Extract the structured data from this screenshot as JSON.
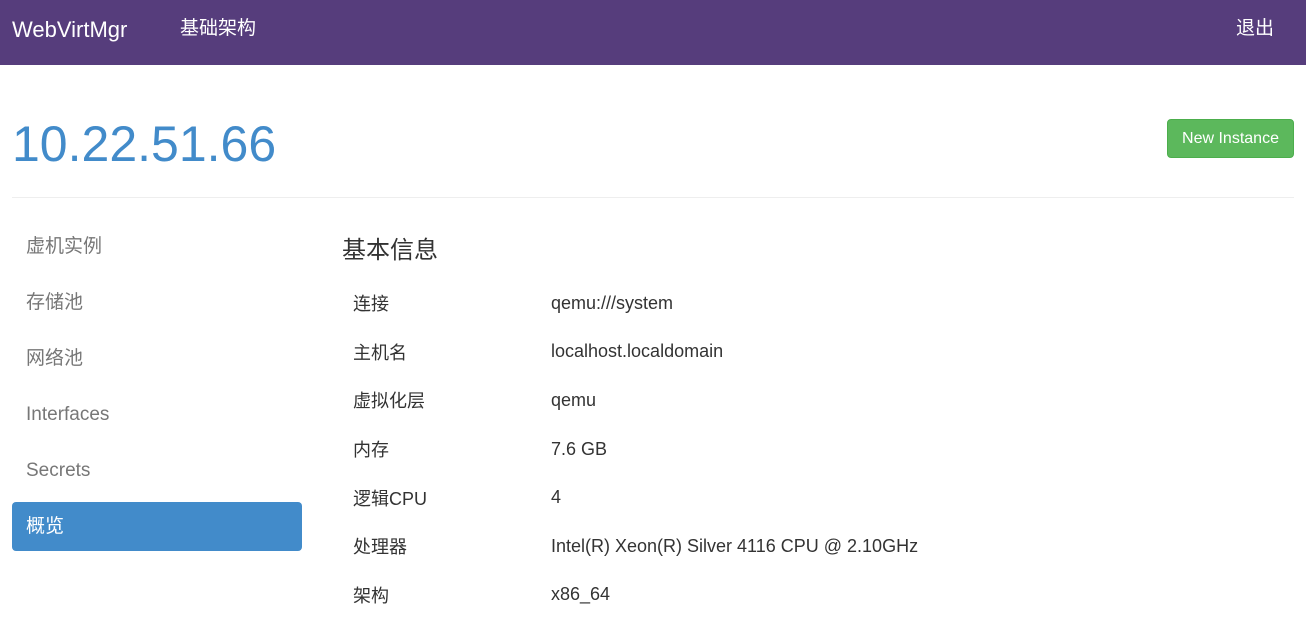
{
  "navbar": {
    "brand": "WebVirtMgr",
    "infrastructure": "基础架构",
    "logout": "退出",
    "background_color": "#563d7c"
  },
  "header": {
    "host_title": "10.22.51.66",
    "new_instance_button": "New Instance",
    "title_color": "#428bca",
    "button_color": "#5cb85c"
  },
  "sidebar": {
    "items": [
      {
        "label": "虚机实例",
        "active": false
      },
      {
        "label": "存储池",
        "active": false
      },
      {
        "label": "网络池",
        "active": false
      },
      {
        "label": "Interfaces",
        "active": false
      },
      {
        "label": "Secrets",
        "active": false
      },
      {
        "label": "概览",
        "active": true
      }
    ],
    "active_color": "#428bca"
  },
  "main": {
    "section_title": "基本信息",
    "rows": [
      {
        "key": "连接",
        "value": "qemu:///system"
      },
      {
        "key": "主机名",
        "value": "localhost.localdomain"
      },
      {
        "key": "虚拟化层",
        "value": "qemu"
      },
      {
        "key": "内存",
        "value": "7.6 GB"
      },
      {
        "key": "逻辑CPU",
        "value": "4"
      },
      {
        "key": "处理器",
        "value": "Intel(R) Xeon(R) Silver 4116 CPU @ 2.10GHz"
      },
      {
        "key": "架构",
        "value": "x86_64"
      }
    ]
  }
}
